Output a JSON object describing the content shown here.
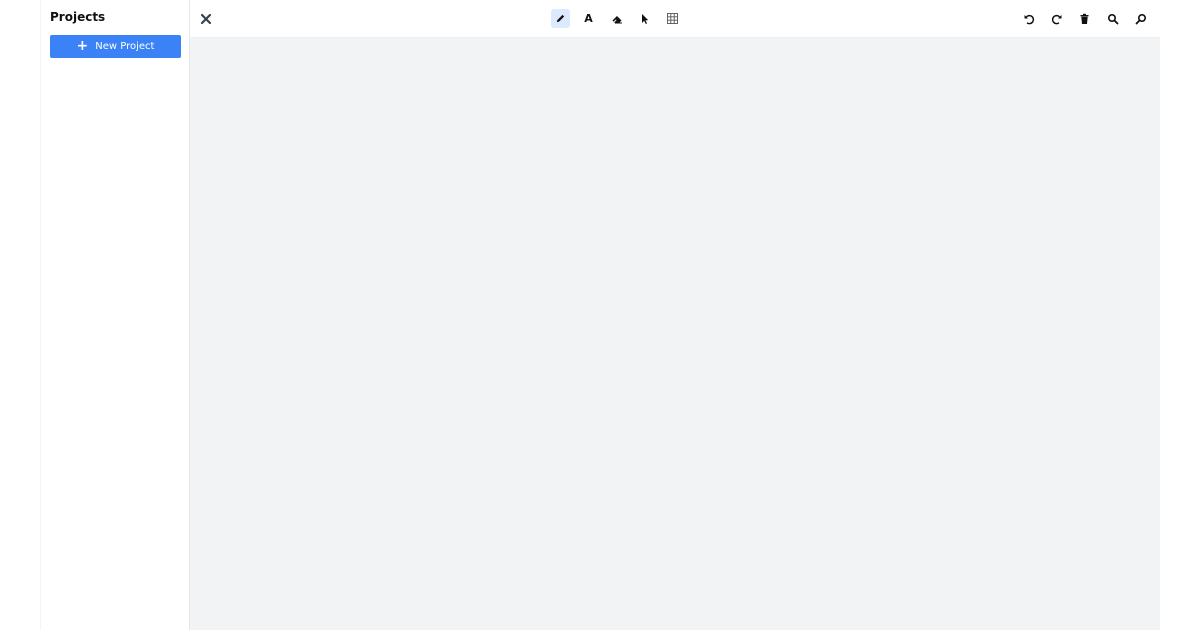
{
  "sidebar": {
    "title": "Projects",
    "new_project": {
      "plus": "+",
      "label": "New Project"
    }
  },
  "toolbar": {
    "left": [
      {
        "name": "close-icon",
        "label": "Close"
      }
    ],
    "tools": [
      {
        "name": "pencil-icon",
        "label": "Draw",
        "active": true
      },
      {
        "name": "text-icon",
        "label": "Text",
        "glyph": "A",
        "active": false
      },
      {
        "name": "eraser-icon",
        "label": "Eraser",
        "active": false
      },
      {
        "name": "cursor-icon",
        "label": "Select",
        "active": false
      },
      {
        "name": "grid-icon",
        "label": "Grid",
        "active": false
      }
    ],
    "actions": [
      {
        "name": "undo-icon",
        "label": "Undo"
      },
      {
        "name": "redo-icon",
        "label": "Redo"
      },
      {
        "name": "trash-icon",
        "label": "Delete"
      },
      {
        "name": "zoom-in-icon",
        "label": "Zoom in"
      },
      {
        "name": "zoom-out-icon",
        "label": "Zoom out"
      }
    ]
  },
  "colors": {
    "accent": "#3b82f6",
    "active_tool_bg": "#dbeafe",
    "canvas_bg": "#f2f3f5",
    "icon": "#111111"
  }
}
